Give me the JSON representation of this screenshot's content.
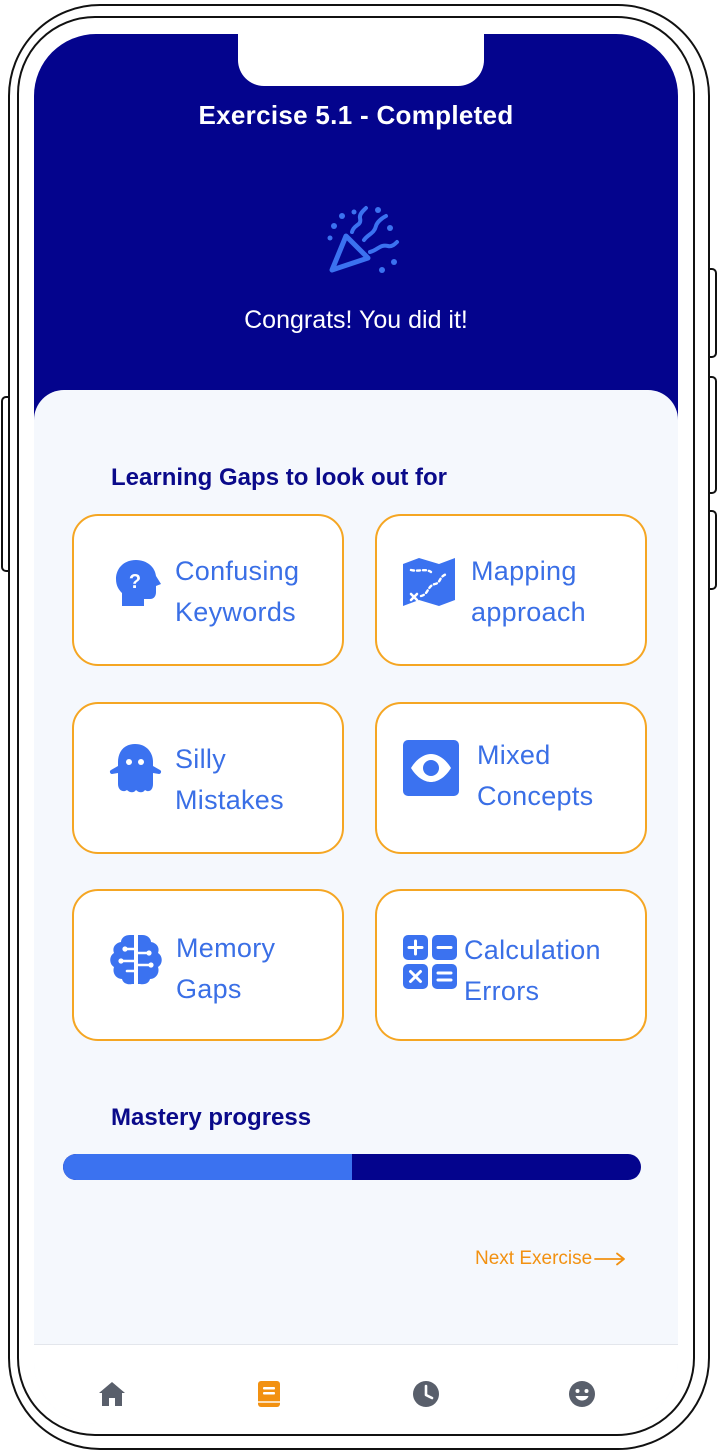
{
  "header": {
    "title": "Exercise 5.1 - Completed",
    "message": "Congrats! You did it!",
    "icon": "party-popper-icon"
  },
  "learning_gaps": {
    "title": "Learning Gaps to look out for",
    "items": [
      {
        "line1": "Confusing",
        "line2": "Keywords",
        "icon": "head-question-icon"
      },
      {
        "line1": "Mapping",
        "line2": "approach",
        "icon": "treasure-map-icon"
      },
      {
        "line1": "Silly",
        "line2": "Mistakes",
        "icon": "ghost-icon"
      },
      {
        "line1": "Mixed",
        "line2": "Concepts",
        "icon": "eye-icon"
      },
      {
        "line1": "Memory",
        "line2": "Gaps",
        "icon": "brain-icon"
      },
      {
        "line1": "Calculation",
        "line2": "Errors",
        "icon": "calculator-icon"
      }
    ]
  },
  "mastery": {
    "title": "Mastery progress",
    "progress_fraction": 0.5
  },
  "next_exercise": {
    "label": "Next Exercise"
  },
  "tabbar": {
    "tabs": [
      {
        "icon": "home-icon",
        "active": false
      },
      {
        "icon": "book-icon",
        "active": true
      },
      {
        "icon": "clock-icon",
        "active": false
      },
      {
        "icon": "smiley-icon",
        "active": false
      }
    ]
  },
  "colors": {
    "primary_navy": "#04048d",
    "accent_blue": "#3b72f0",
    "card_border_orange": "#f5a623",
    "link_orange": "#f29111",
    "tab_inactive": "#595f6b",
    "tab_active": "#f29111"
  }
}
